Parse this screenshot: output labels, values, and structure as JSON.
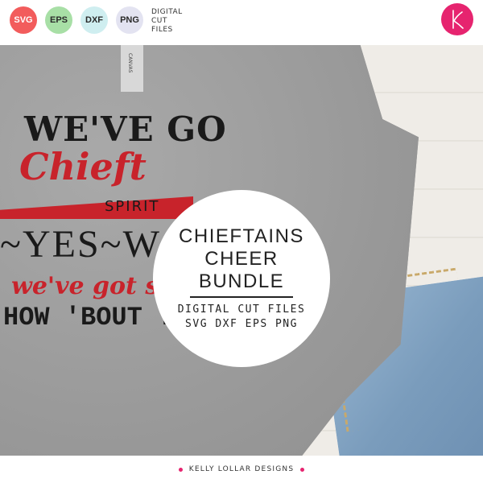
{
  "header": {
    "badges": [
      {
        "label": "SVG",
        "color": "#f25c5c"
      },
      {
        "label": "EPS",
        "color": "#a8dfa6"
      },
      {
        "label": "DXF",
        "color": "#cfeef0"
      },
      {
        "label": "PNG",
        "color": "#e3e3f1"
      }
    ],
    "digital_label": [
      "DIGITAL",
      "CUT",
      "FILES"
    ],
    "logo": {
      "icon": "k-monogram-icon",
      "color": "#e6246f"
    }
  },
  "shirt_design": {
    "line1": "WE'VE GO",
    "line2": "Chieft",
    "line3": "SPIRIT",
    "line4": "~YES~W",
    "line5": "we've got s",
    "line6": "HOW 'BOUT YOU!",
    "tag_text": "CANVAS",
    "colors": {
      "black": "#1a1a1a",
      "red": "#c8232b",
      "shirt": "#9c9c9c"
    }
  },
  "circle": {
    "title": [
      "CHIEFTAINS",
      "CHEER",
      "BUNDLE"
    ],
    "subtitle": [
      "DIGITAL CUT FILES",
      "SVG DXF EPS PNG"
    ]
  },
  "footer": {
    "text": "KELLY LOLLAR DESIGNS",
    "dot_color": "#e6246f"
  }
}
